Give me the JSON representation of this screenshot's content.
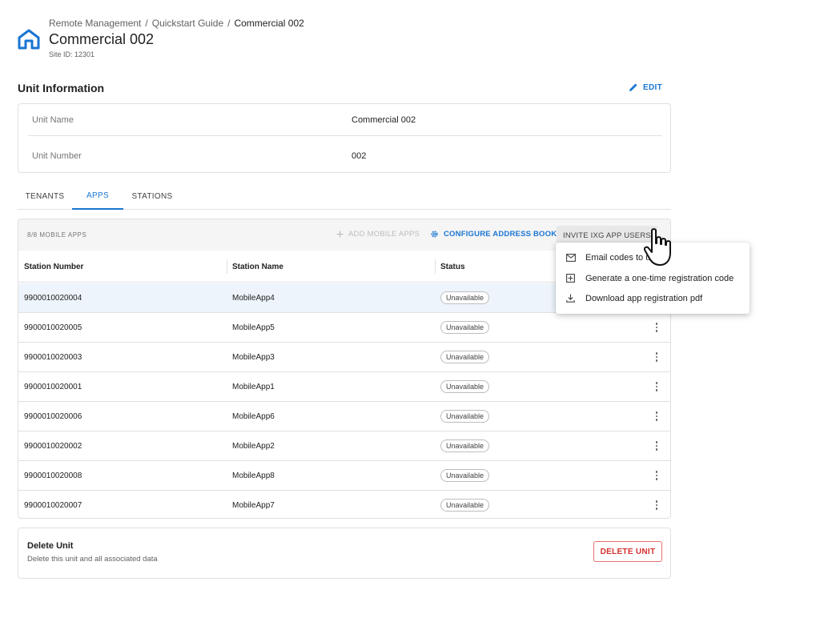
{
  "breadcrumb": {
    "items": [
      "Remote Management",
      "Quickstart Guide",
      "Commercial 002"
    ],
    "separator": "/"
  },
  "site": {
    "title": "Commercial 002",
    "id_text": "Site ID: 12301"
  },
  "unit_info": {
    "title": "Unit Information",
    "edit_label": "EDIT",
    "fields": [
      {
        "label": "Unit Name",
        "value": "Commercial 002"
      },
      {
        "label": "Unit Number",
        "value": "002"
      }
    ]
  },
  "tabs": [
    {
      "label": "TENANTS",
      "active": false
    },
    {
      "label": "APPS",
      "active": true
    },
    {
      "label": "STATIONS",
      "active": false
    }
  ],
  "apps_table": {
    "count_label": "8/8 MOBILE APPS",
    "add_label": "ADD MOBILE APPS",
    "configure_label": "CONFIGURE ADDRESS BOOK",
    "invite_label": "INVITE IXG APP USERS",
    "columns": [
      "Station Number",
      "Station Name",
      "Status"
    ],
    "rows": [
      {
        "number": "9900010020004",
        "name": "MobileApp4",
        "status": "Unavailable",
        "selected": true
      },
      {
        "number": "9900010020005",
        "name": "MobileApp5",
        "status": "Unavailable",
        "selected": false
      },
      {
        "number": "9900010020003",
        "name": "MobileApp3",
        "status": "Unavailable",
        "selected": false
      },
      {
        "number": "9900010020001",
        "name": "MobileApp1",
        "status": "Unavailable",
        "selected": false
      },
      {
        "number": "9900010020006",
        "name": "MobileApp6",
        "status": "Unavailable",
        "selected": false
      },
      {
        "number": "9900010020002",
        "name": "MobileApp2",
        "status": "Unavailable",
        "selected": false
      },
      {
        "number": "9900010020008",
        "name": "MobileApp8",
        "status": "Unavailable",
        "selected": false
      },
      {
        "number": "9900010020007",
        "name": "MobileApp7",
        "status": "Unavailable",
        "selected": false
      }
    ]
  },
  "invite_menu": {
    "items": [
      {
        "label": "Email codes to users",
        "icon": "mail-icon"
      },
      {
        "label": "Generate a one-time registration code",
        "icon": "plus-box-icon"
      },
      {
        "label": "Download app registration pdf",
        "icon": "download-icon"
      }
    ]
  },
  "delete_unit": {
    "title": "Delete Unit",
    "description": "Delete this unit and all associated data",
    "button_label": "DELETE UNIT"
  },
  "colors": {
    "accent": "#1976d2",
    "danger": "#d32f2f",
    "selected_row": "#eef4fb",
    "toolbar_bg": "#f5f5f5"
  }
}
